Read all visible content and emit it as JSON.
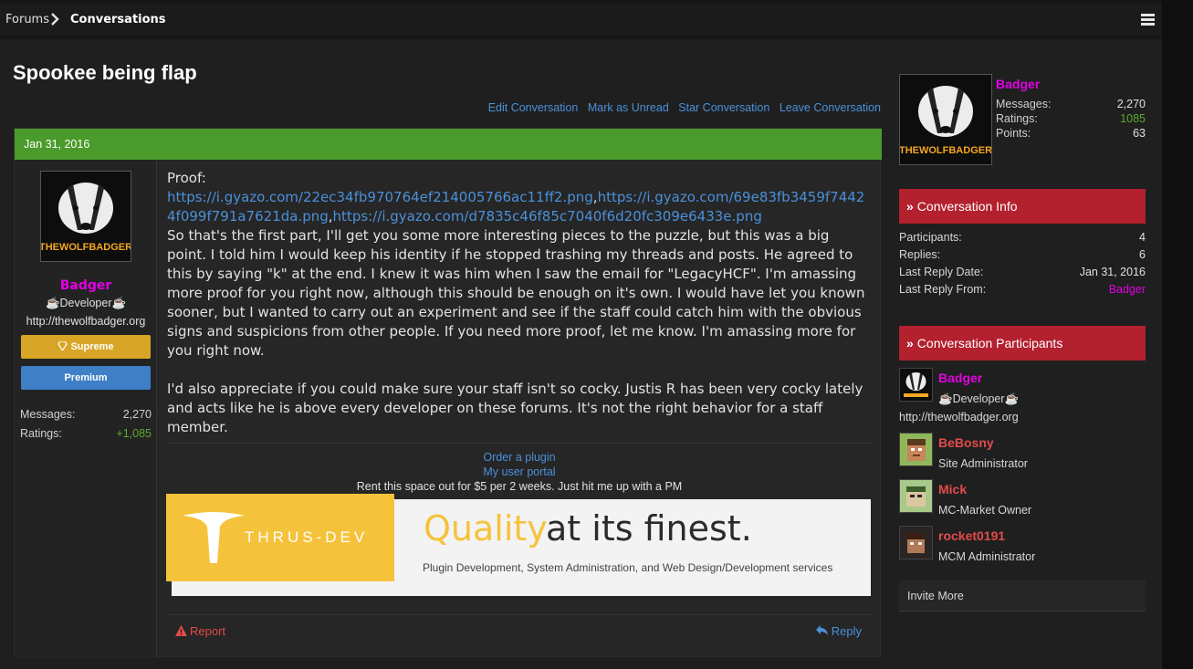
{
  "breadcrumb": {
    "forums": "Forums",
    "current": "Conversations"
  },
  "page_title": "Spookee being flap",
  "conversation_actions": [
    "Edit Conversation",
    "Mark as Unread",
    "Star Conversation",
    "Leave Conversation"
  ],
  "message": {
    "date": "Jan 31, 2016",
    "author": {
      "name": "Badger",
      "avatar_text": "THEWOLFBADGER",
      "role": "☕Developer☕",
      "website": "http://thewolfbadger.org",
      "badges": [
        "Supreme",
        "Premium"
      ],
      "stats": [
        {
          "label": "Messages:",
          "value": "2,270"
        },
        {
          "label": "Ratings:",
          "value": "+1,085"
        }
      ]
    },
    "body": {
      "intro": "Proof:",
      "links": [
        "https://i.gyazo.com/22ec34fb970764ef214005766ac11ff2.png",
        "https://i.gyazo.com/69e83fb3459f74424f099f791a7621da.png",
        "https://i.gyazo.com/d7835c46f85c7040f6d20fc309e6433e.png"
      ],
      "paragraph1": "So that's the first part, I'll get you some more interesting pieces to the puzzle, but this was a big point. I told him I would keep his identity if he stopped trashing my threads and posts. He agreed to this by saying \"k\" at the end. I knew it was him when I saw the email for \"LegacyHCF\". I'm amassing more proof for you right now, although this should be enough on it's own. I would have let you known sooner, but I wanted to carry out an experiment and see if the staff could catch him with the obvious signs and suspicions from other people. If you need more proof, let me know. I'm amassing more for you right now.",
      "paragraph2": "I'd also appreciate if you could make sure your staff isn't so cocky. Justis R has been very cocky lately and acts like he is above every developer on these forums. It's not the right behavior for a staff member."
    },
    "signature": {
      "links": [
        "Order a plugin",
        "My user portal"
      ],
      "rent_text": "Rent this space out for $5 per 2 weeks. Just hit me up with a PM",
      "banner": {
        "brand": "THRUS-DEV",
        "headline_accent": "Quality",
        "headline_rest": "at its finest.",
        "subtitle": "Plugin Development, System Administration, and Web Design/Development services"
      }
    },
    "report_label": "Report",
    "reply_label": "Reply"
  },
  "sidebar": {
    "user": {
      "name": "Badger",
      "stats": [
        {
          "label": "Messages:",
          "value": "2,270"
        },
        {
          "label": "Ratings:",
          "value": "1085"
        },
        {
          "label": "Points:",
          "value": "63"
        }
      ]
    },
    "conversation_info": {
      "title": "Conversation Info",
      "rows": [
        {
          "label": "Participants:",
          "value": "4"
        },
        {
          "label": "Replies:",
          "value": "6"
        },
        {
          "label": "Last Reply Date:",
          "value": "Jan 31, 2016"
        },
        {
          "label": "Last Reply From:",
          "value": "Badger"
        }
      ]
    },
    "participants": {
      "title": "Conversation Participants",
      "list": [
        {
          "name": "Badger",
          "title": "☕Developer☕",
          "extra": "http://thewolfbadger.org"
        },
        {
          "name": "BeBosny",
          "title": "Site Administrator"
        },
        {
          "name": "Mick",
          "title": "MC-Market Owner"
        },
        {
          "name": "rocket0191",
          "title": "MCM Administrator"
        }
      ]
    },
    "invite_label": "Invite More"
  },
  "colors": {
    "accent_green": "#4a9b2b",
    "accent_red": "#b3202e",
    "link_blue": "#4a90d9",
    "username_magenta": "#e300e3",
    "staff_red": "#e34b4b",
    "positive_green": "#5fa82c",
    "supreme_gold": "#d8a526",
    "premium_blue": "#3f7fc6"
  }
}
